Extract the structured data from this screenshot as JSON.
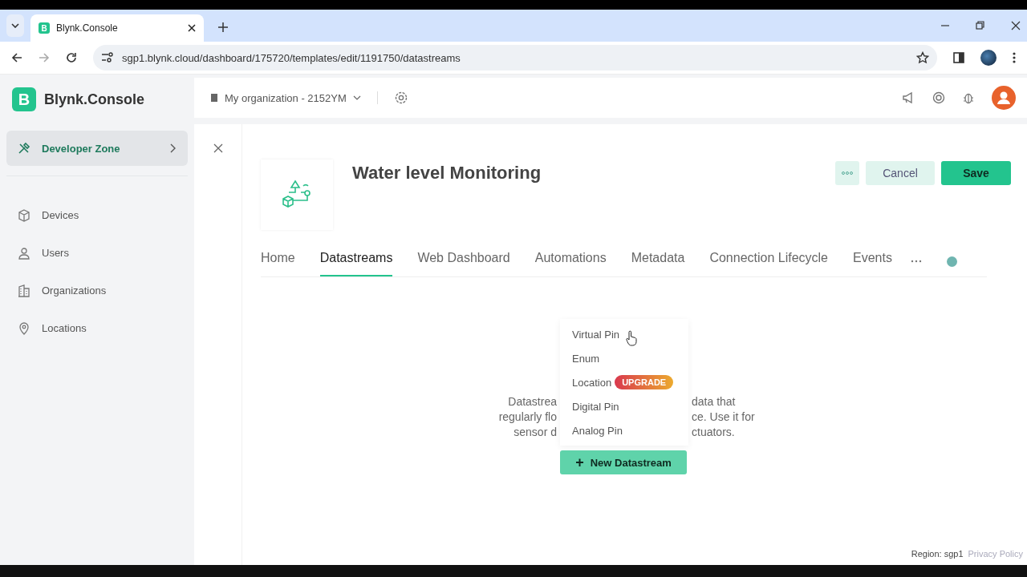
{
  "browser": {
    "tab_title": "Blynk.Console",
    "favicon": "B",
    "url": "sgp1.blynk.cloud/dashboard/175720/templates/edit/1191750/datastreams"
  },
  "brand": {
    "logo": "B",
    "name": "Blynk.Console"
  },
  "sidebar": [
    {
      "label": "Developer Zone",
      "selected": true
    },
    {
      "label": "Devices",
      "selected": false
    },
    {
      "label": "Users",
      "selected": false
    },
    {
      "label": "Organizations",
      "selected": false
    },
    {
      "label": "Locations",
      "selected": false
    }
  ],
  "org": "My organization - 2152YM",
  "template": {
    "title": "Water level Monitoring"
  },
  "actions": [
    "Cancel",
    "Save"
  ],
  "tabs": [
    {
      "label": "Home",
      "selected": false
    },
    {
      "label": "Datastreams",
      "selected": true
    },
    {
      "label": "Web Dashboard",
      "selected": false
    },
    {
      "label": "Automations",
      "selected": false
    },
    {
      "label": "Metadata",
      "selected": false
    },
    {
      "label": "Connection Lifecycle",
      "selected": false
    },
    {
      "label": "Events",
      "selected": false
    }
  ],
  "description_lines": [
    {
      "left": "Datastrea",
      "right": "data that"
    },
    {
      "left": "regularly flo",
      "right": "ce. Use it for"
    },
    {
      "left": "sensor d",
      "right": "ctuators."
    }
  ],
  "menu": [
    {
      "label": "Virtual Pin"
    },
    {
      "label": "Enum"
    },
    {
      "label": "Location",
      "badge": "UPGRADE"
    },
    {
      "label": "Digital Pin"
    },
    {
      "label": "Analog Pin"
    }
  ],
  "new_button": {
    "icon": "+",
    "label": "New Datastream"
  },
  "footer": {
    "region": "Region: sgp1",
    "privacy": "Privacy Policy"
  }
}
